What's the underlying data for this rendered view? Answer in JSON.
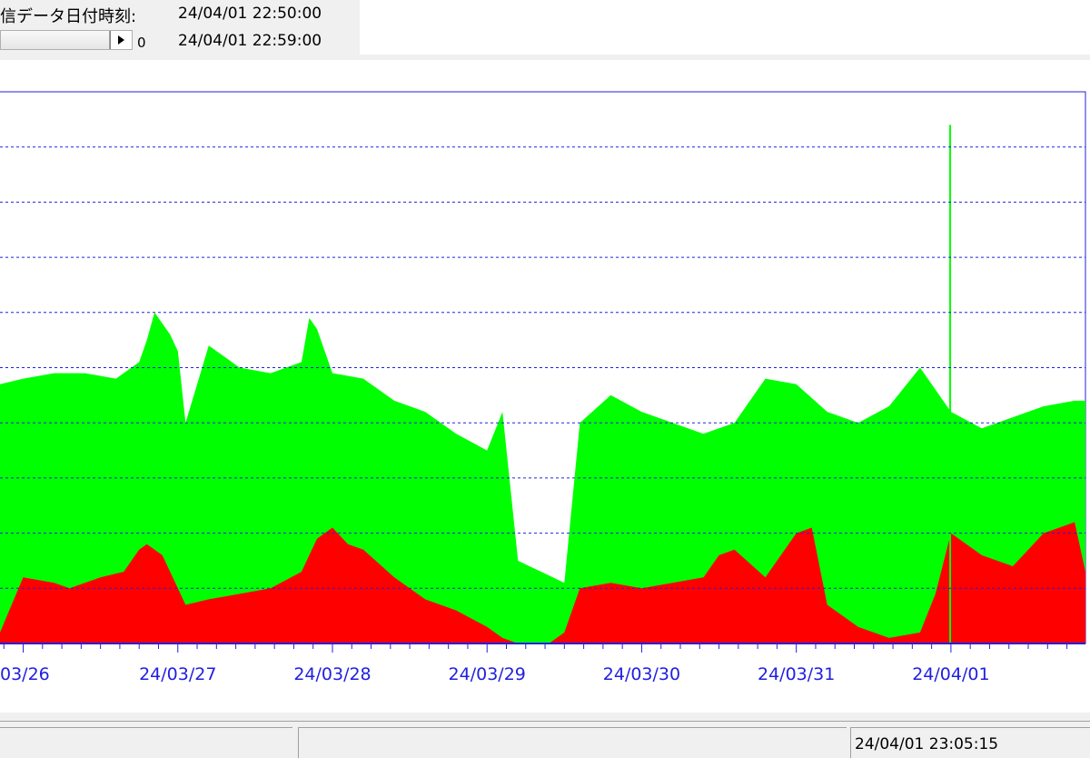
{
  "header": {
    "label": "信データ日付時刻:",
    "start_time": "24/04/01 22:50:00",
    "end_time": "24/04/01 22:59:00",
    "scroll_value": "0"
  },
  "status_bar": {
    "time": "24/04/01 23:05:15"
  },
  "colors": {
    "upper_series": "#00ff00",
    "lower_series": "#ff0000",
    "axis": "#2020e0",
    "grid": "#2020e0"
  },
  "chart_data": {
    "type": "area",
    "title": "",
    "xlabel": "",
    "ylabel": "",
    "grid": true,
    "stacked": false,
    "x_ticks": [
      "03/26",
      "24/03/27",
      "24/03/28",
      "24/03/29",
      "24/03/30",
      "24/03/31",
      "24/04/01"
    ],
    "x_range": [
      -0.15,
      6.87
    ],
    "y_range": [
      0,
      100
    ],
    "gridlines": [
      10,
      20,
      30,
      40,
      50,
      60,
      70,
      80,
      90
    ],
    "series": [
      {
        "x": [
          -0.15,
          0.0,
          0.2,
          0.4,
          0.6,
          0.75,
          0.8,
          0.85,
          0.95,
          1.0,
          1.05,
          1.2,
          1.25,
          1.4,
          1.6,
          1.8,
          1.85,
          1.9,
          2.0,
          2.2,
          2.4,
          2.6,
          2.8,
          3.0,
          3.1,
          3.2,
          3.5,
          3.6,
          3.8,
          4.0,
          4.2,
          4.4,
          4.6,
          4.8,
          5.0,
          5.2,
          5.4,
          5.6,
          5.8,
          6.0,
          6.2,
          6.4,
          6.6,
          6.8,
          6.87
        ],
        "values": [
          47,
          48,
          49,
          49,
          48,
          51,
          55,
          60,
          56,
          53,
          40,
          54,
          53,
          50,
          49,
          51,
          59,
          57,
          49,
          48,
          44,
          42,
          38,
          35,
          42,
          15,
          11,
          40,
          45,
          42,
          40,
          38,
          40,
          48,
          47,
          42,
          40,
          43,
          50,
          42,
          39,
          41,
          43,
          44,
          44
        ]
      },
      {
        "x": [
          -0.15,
          0.0,
          0.2,
          0.3,
          0.5,
          0.65,
          0.75,
          0.8,
          0.9,
          1.0,
          1.05,
          1.2,
          1.4,
          1.6,
          1.8,
          1.9,
          2.0,
          2.1,
          2.2,
          2.4,
          2.6,
          2.8,
          3.0,
          3.1,
          3.2,
          3.4,
          3.5,
          3.6,
          3.8,
          4.0,
          4.2,
          4.4,
          4.5,
          4.6,
          4.8,
          4.9,
          5.0,
          5.1,
          5.2,
          5.4,
          5.6,
          5.8,
          5.9,
          6.0,
          6.2,
          6.4,
          6.6,
          6.8,
          6.87
        ],
        "values": [
          2,
          12,
          11,
          10,
          12,
          13,
          17,
          18,
          16,
          10,
          7,
          8,
          9,
          10,
          13,
          19,
          21,
          18,
          17,
          12,
          8,
          6,
          3,
          1,
          0,
          0,
          2,
          10,
          11,
          10,
          11,
          12,
          16,
          17,
          12,
          16,
          20,
          21,
          7,
          3,
          1,
          2,
          9,
          20,
          16,
          14,
          20,
          22,
          13
        ]
      }
    ],
    "spikes": [
      {
        "x": 5.995,
        "value": 94
      }
    ]
  }
}
